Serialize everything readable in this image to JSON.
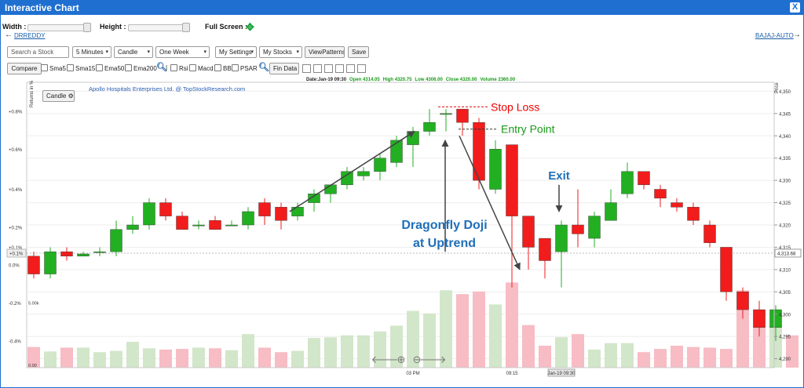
{
  "window": {
    "title": "Interactive Chart",
    "close": "X"
  },
  "controls": {
    "width_label": "Width :",
    "height_label": "Height :",
    "fullscreen_label": "Full Screen :",
    "prev_stock": "DRREDDY",
    "next_stock": "BAJAJ-AUTO",
    "search_placeholder": "Search a Stock",
    "interval": "5 Minutes",
    "chart_type": "Candle",
    "period": "One Week",
    "settings": "My Settings",
    "stocks": "My Stocks",
    "view_patterns": "ViewPatterns",
    "save": "Save",
    "compare": "Compare",
    "indicators": [
      "Sma5",
      "Sma15",
      "Ema50",
      "Ema200",
      "Rsi",
      "Macd",
      "BB",
      "PSAR"
    ],
    "fin_data": "Fin Data",
    "tools": [
      "line",
      "hline",
      "vline",
      "fib",
      "fibfan",
      "camera"
    ],
    "candle_badge": "Candle"
  },
  "colors": {
    "up": "#22b022",
    "down": "#f21c1c",
    "vol_up": "#d2e6c9",
    "vol_down": "#f7bcc4",
    "accent": "#1f6fd1"
  },
  "chart_data": {
    "type": "candlestick",
    "title": "Apollo Hospitals Enterprises Ltd. @ TopStockResearch.com",
    "ohlc_label": {
      "date": "Date:Jan-19 09:30",
      "open": "Open 4314.05",
      "high": "High 4320.75",
      "low": "Low 4306.00",
      "close": "Close 4320.00",
      "volume": "Volume 2360.00"
    },
    "y_right_label": "Price",
    "y_left_label": "Returns in %",
    "ylim": [
      4288,
      4352
    ],
    "y_ticks": [
      4290,
      4295,
      4300,
      4305,
      4310,
      4315,
      4320,
      4325,
      4330,
      4335,
      4340,
      4345,
      4350
    ],
    "left_ticks": [
      {
        "label": "+0.8%",
        "price": 4345.5
      },
      {
        "label": "+0.6%",
        "price": 4337
      },
      {
        "label": "+0.4%",
        "price": 4328
      },
      {
        "label": "+0.2%",
        "price": 4319.5
      },
      {
        "label": "+0.1%",
        "price": 4315
      },
      {
        "label": "0.0%",
        "price": 4311
      },
      {
        "label": "-0.2%",
        "price": 4302.5
      },
      {
        "label": "-0.4%",
        "price": 4294
      }
    ],
    "last_price_label": "4,313.68",
    "last_price": 4313.68,
    "volume_scale_label": "5.00k",
    "volume_zero_label": "0.00",
    "volume_max": 6200,
    "x_labels": [
      {
        "label": "03 PM",
        "index": 23
      },
      {
        "label": "09:15",
        "index": 29
      },
      {
        "label": "Jan-19 09:30",
        "index": 32,
        "highlight": true
      }
    ],
    "candles": [
      {
        "o": 4313,
        "h": 4314,
        "l": 4308,
        "c": 4309
      },
      {
        "o": 4309,
        "h": 4315,
        "l": 4308,
        "c": 4314
      },
      {
        "o": 4314,
        "h": 4315,
        "l": 4312,
        "c": 4313
      },
      {
        "o": 4313,
        "h": 4314,
        "l": 4313,
        "c": 4313.5
      },
      {
        "o": 4314,
        "h": 4315,
        "l": 4313,
        "c": 4314
      },
      {
        "o": 4314,
        "h": 4321,
        "l": 4313,
        "c": 4319
      },
      {
        "o": 4319,
        "h": 4322,
        "l": 4318,
        "c": 4320
      },
      {
        "o": 4320,
        "h": 4326,
        "l": 4319,
        "c": 4325
      },
      {
        "o": 4325,
        "h": 4326,
        "l": 4321,
        "c": 4322
      },
      {
        "o": 4322,
        "h": 4323,
        "l": 4319,
        "c": 4319
      },
      {
        "o": 4320,
        "h": 4321,
        "l": 4319,
        "c": 4320
      },
      {
        "o": 4321,
        "h": 4322,
        "l": 4319,
        "c": 4319
      },
      {
        "o": 4320,
        "h": 4321,
        "l": 4320,
        "c": 4320
      },
      {
        "o": 4320,
        "h": 4324,
        "l": 4319,
        "c": 4323
      },
      {
        "o": 4325,
        "h": 4326,
        "l": 4320,
        "c": 4322
      },
      {
        "o": 4324,
        "h": 4325,
        "l": 4319,
        "c": 4321
      },
      {
        "o": 4322,
        "h": 4325,
        "l": 4321,
        "c": 4324
      },
      {
        "o": 4325,
        "h": 4328,
        "l": 4323,
        "c": 4327
      },
      {
        "o": 4327,
        "h": 4329,
        "l": 4325,
        "c": 4329
      },
      {
        "o": 4329,
        "h": 4333,
        "l": 4328,
        "c": 4332
      },
      {
        "o": 4331,
        "h": 4333,
        "l": 4330,
        "c": 4332
      },
      {
        "o": 4332,
        "h": 4336,
        "l": 4330,
        "c": 4335
      },
      {
        "o": 4334,
        "h": 4340,
        "l": 4333,
        "c": 4339
      },
      {
        "o": 4338,
        "h": 4342,
        "l": 4333,
        "c": 4341
      },
      {
        "o": 4341,
        "h": 4346,
        "l": 4340,
        "c": 4343
      },
      {
        "o": 4345,
        "h": 4346,
        "l": 4341,
        "c": 4345
      },
      {
        "o": 4346,
        "h": 4346,
        "l": 4340,
        "c": 4343
      },
      {
        "o": 4343,
        "h": 4344,
        "l": 4328,
        "c": 4330
      },
      {
        "o": 4328,
        "h": 4339,
        "l": 4327,
        "c": 4337
      },
      {
        "o": 4338,
        "h": 4338,
        "l": 4306,
        "c": 4322
      },
      {
        "o": 4322,
        "h": 4322,
        "l": 4310,
        "c": 4315
      },
      {
        "o": 4317,
        "h": 4317,
        "l": 4308,
        "c": 4312
      },
      {
        "o": 4314,
        "h": 4321,
        "l": 4306,
        "c": 4320
      },
      {
        "o": 4320,
        "h": 4328,
        "l": 4315,
        "c": 4318
      },
      {
        "o": 4317,
        "h": 4323,
        "l": 4315,
        "c": 4322
      },
      {
        "o": 4321,
        "h": 4328,
        "l": 4321,
        "c": 4325
      },
      {
        "o": 4327,
        "h": 4334,
        "l": 4326,
        "c": 4332
      },
      {
        "o": 4332,
        "h": 4332,
        "l": 4328,
        "c": 4329
      },
      {
        "o": 4328,
        "h": 4329,
        "l": 4324,
        "c": 4326
      },
      {
        "o": 4325,
        "h": 4326,
        "l": 4323,
        "c": 4324
      },
      {
        "o": 4324,
        "h": 4325,
        "l": 4320,
        "c": 4321
      },
      {
        "o": 4320,
        "h": 4321,
        "l": 4315,
        "c": 4316
      },
      {
        "o": 4315,
        "h": 4315,
        "l": 4303,
        "c": 4305
      },
      {
        "o": 4305,
        "h": 4306,
        "l": 4299,
        "c": 4301
      },
      {
        "o": 4301,
        "h": 4303,
        "l": 4295,
        "c": 4297
      },
      {
        "o": 4297,
        "h": 4302,
        "l": 4294,
        "c": 4301
      }
    ],
    "volumes": [
      1600,
      1250,
      1550,
      1550,
      1200,
      1300,
      2000,
      1500,
      1400,
      1450,
      1550,
      1500,
      1350,
      2600,
      1550,
      1200,
      1300,
      2300,
      2350,
      2500,
      2500,
      2800,
      3250,
      4400,
      4200,
      6000,
      5700,
      5900,
      4900,
      6600,
      3300,
      1700,
      2360,
      2600,
      1400,
      1900,
      1900,
      1200,
      1450,
      1700,
      1600,
      1550,
      1450,
      6000,
      4500,
      3300,
      2500
    ]
  },
  "annotations": {
    "stop_loss": "Stop Loss",
    "entry_point": "Entry Point",
    "exit": "Exit",
    "pattern_line1": "Dragonfly Doji",
    "pattern_line2": "at Uptrend"
  }
}
